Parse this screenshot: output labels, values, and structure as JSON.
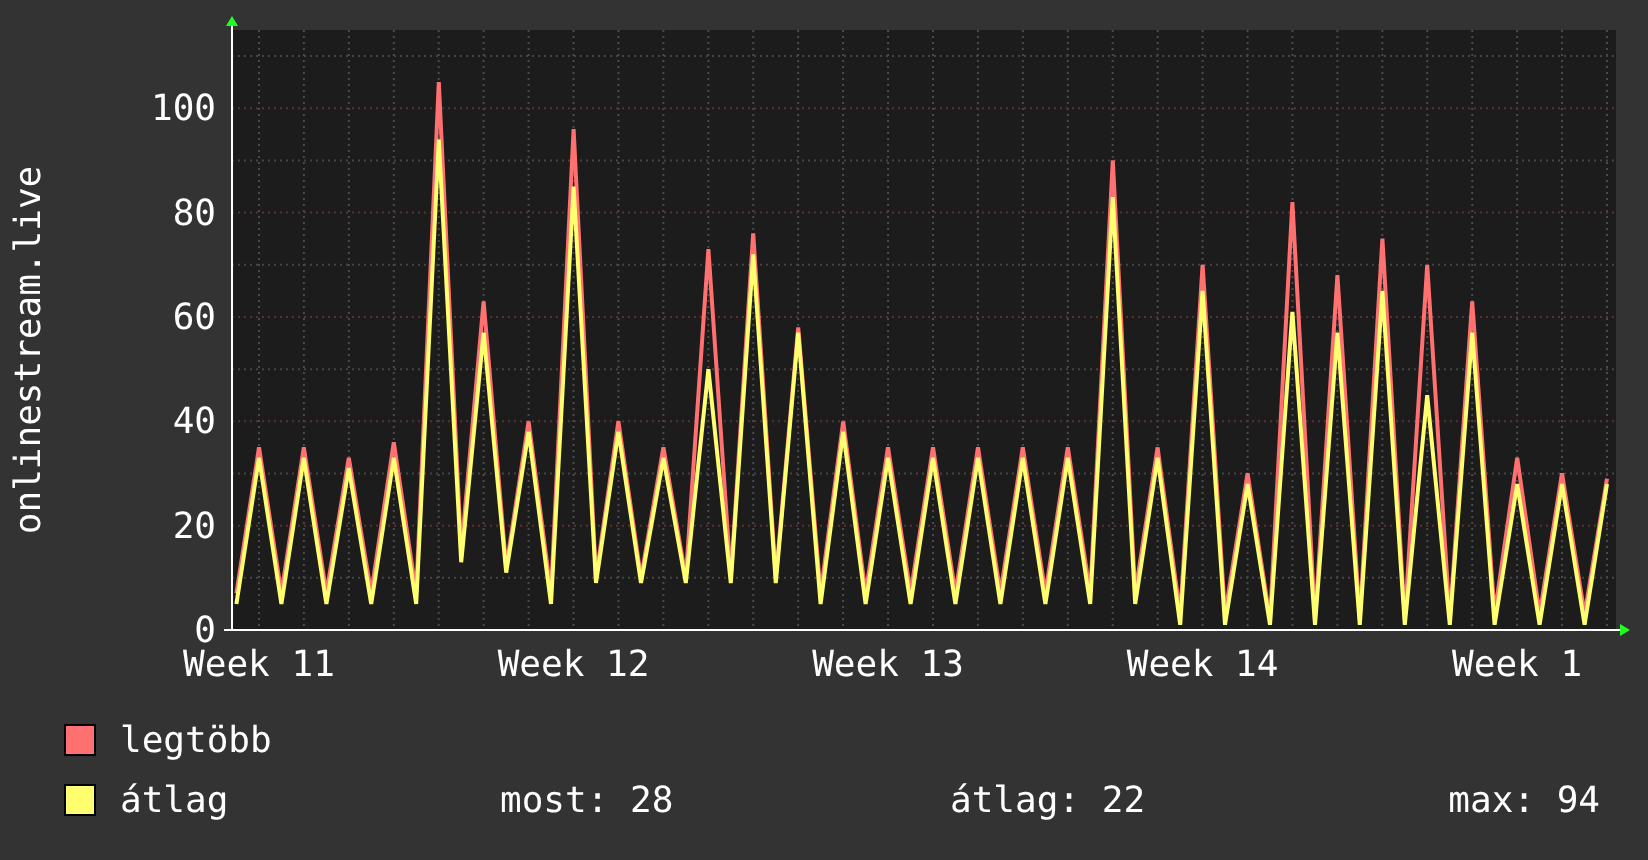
{
  "graph": {
    "chart_data": {
      "type": "line",
      "ylabel": "onlinestream.live",
      "categories": [
        null,
        "Week 11",
        null,
        null,
        null,
        null,
        null,
        null,
        null,
        null,
        null,
        null,
        null,
        null,
        null,
        "Week 12",
        null,
        null,
        null,
        null,
        null,
        null,
        null,
        null,
        null,
        null,
        null,
        null,
        null,
        "Week 13",
        null,
        null,
        null,
        null,
        null,
        null,
        null,
        null,
        null,
        null,
        null,
        null,
        null,
        "Week 14",
        null,
        null,
        null,
        null,
        null,
        null,
        null,
        null,
        null,
        null,
        null,
        null,
        null,
        "Week 1",
        null,
        null,
        null,
        null
      ],
      "series": [
        {
          "name": "legtöbb",
          "color": "#ff7070",
          "values": [
            7,
            35,
            7,
            35,
            7,
            33,
            7,
            36,
            7,
            105,
            15,
            63,
            12,
            40,
            7,
            96,
            10,
            40,
            10,
            35,
            10,
            73,
            10,
            76,
            10,
            58,
            7,
            40,
            7,
            35,
            7,
            35,
            7,
            35,
            7,
            35,
            7,
            35,
            7,
            90,
            7,
            35,
            3,
            70,
            3,
            30,
            2,
            82,
            2,
            68,
            2,
            75,
            2,
            70,
            2,
            63,
            3,
            33,
            3,
            30,
            3,
            29
          ]
        },
        {
          "name": "átlag",
          "color": "#ffff70",
          "values": [
            5,
            33,
            5,
            33,
            5,
            31,
            5,
            33,
            5,
            94,
            13,
            57,
            11,
            38,
            5,
            85,
            9,
            38,
            9,
            33,
            9,
            50,
            9,
            72,
            9,
            57,
            5,
            38,
            5,
            33,
            5,
            33,
            5,
            33,
            5,
            33,
            5,
            33,
            5,
            83,
            5,
            33,
            1,
            65,
            1,
            28,
            1,
            61,
            1,
            57,
            1,
            65,
            1,
            45,
            1,
            57,
            1,
            28,
            1,
            28,
            1,
            28
          ]
        }
      ],
      "grid": true,
      "ylim": [
        0,
        115
      ],
      "yticks": [
        0,
        20,
        40,
        60,
        80,
        100
      ]
    }
  },
  "stats": [
    "most: 28",
    "átlag: 22",
    "max: 94"
  ]
}
